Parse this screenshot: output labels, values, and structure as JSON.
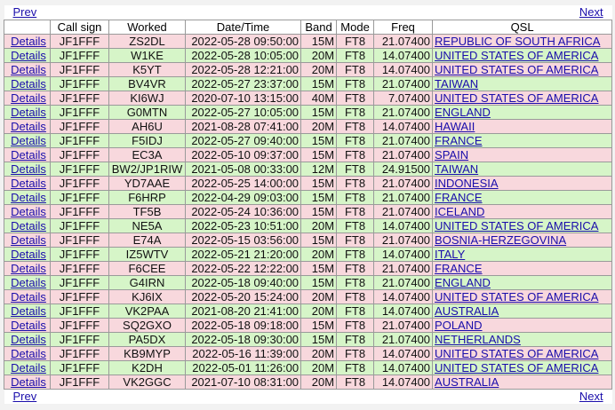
{
  "nav": {
    "prev": "Prev",
    "next": "Next"
  },
  "headers": [
    "",
    "Call sign",
    "Worked",
    "Date/Time",
    "Band",
    "Mode",
    "Freq",
    "QSL"
  ],
  "details_label": "Details",
  "rows": [
    {
      "call": "JF1FFF",
      "worked": "ZS2DL",
      "dt": "2022-05-28 09:50:00",
      "band": "15M",
      "mode": "FT8",
      "freq": "21.07400",
      "qsl": "REPUBLIC OF SOUTH AFRICA"
    },
    {
      "call": "JF1FFF",
      "worked": "W1KE",
      "dt": "2022-05-28 10:05:00",
      "band": "20M",
      "mode": "FT8",
      "freq": "14.07400",
      "qsl": "UNITED STATES OF AMERICA"
    },
    {
      "call": "JF1FFF",
      "worked": "K5YT",
      "dt": "2022-05-28 12:21:00",
      "band": "20M",
      "mode": "FT8",
      "freq": "14.07400",
      "qsl": "UNITED STATES OF AMERICA"
    },
    {
      "call": "JF1FFF",
      "worked": "BV4VR",
      "dt": "2022-05-27 23:37:00",
      "band": "15M",
      "mode": "FT8",
      "freq": "21.07400",
      "qsl": "TAIWAN"
    },
    {
      "call": "JF1FFF",
      "worked": "KI6WJ",
      "dt": "2020-07-10 13:15:00",
      "band": "40M",
      "mode": "FT8",
      "freq": "7.07400",
      "qsl": "UNITED STATES OF AMERICA"
    },
    {
      "call": "JF1FFF",
      "worked": "G0MTN",
      "dt": "2022-05-27 10:05:00",
      "band": "15M",
      "mode": "FT8",
      "freq": "21.07400",
      "qsl": "ENGLAND"
    },
    {
      "call": "JF1FFF",
      "worked": "AH6U",
      "dt": "2021-08-28 07:41:00",
      "band": "20M",
      "mode": "FT8",
      "freq": "14.07400",
      "qsl": "HAWAII"
    },
    {
      "call": "JF1FFF",
      "worked": "F5IDJ",
      "dt": "2022-05-27 09:40:00",
      "band": "15M",
      "mode": "FT8",
      "freq": "21.07400",
      "qsl": "FRANCE"
    },
    {
      "call": "JF1FFF",
      "worked": "EC3A",
      "dt": "2022-05-10 09:37:00",
      "band": "15M",
      "mode": "FT8",
      "freq": "21.07400",
      "qsl": "SPAIN"
    },
    {
      "call": "JF1FFF",
      "worked": "BW2/JP1RIW",
      "dt": "2021-05-08 00:33:00",
      "band": "12M",
      "mode": "FT8",
      "freq": "24.91500",
      "qsl": "TAIWAN"
    },
    {
      "call": "JF1FFF",
      "worked": "YD7AAE",
      "dt": "2022-05-25 14:00:00",
      "band": "15M",
      "mode": "FT8",
      "freq": "21.07400",
      "qsl": "INDONESIA"
    },
    {
      "call": "JF1FFF",
      "worked": "F6HRP",
      "dt": "2022-04-29 09:03:00",
      "band": "15M",
      "mode": "FT8",
      "freq": "21.07400",
      "qsl": "FRANCE"
    },
    {
      "call": "JF1FFF",
      "worked": "TF5B",
      "dt": "2022-05-24 10:36:00",
      "band": "15M",
      "mode": "FT8",
      "freq": "21.07400",
      "qsl": "ICELAND"
    },
    {
      "call": "JF1FFF",
      "worked": "NE5A",
      "dt": "2022-05-23 10:51:00",
      "band": "20M",
      "mode": "FT8",
      "freq": "14.07400",
      "qsl": "UNITED STATES OF AMERICA"
    },
    {
      "call": "JF1FFF",
      "worked": "E74A",
      "dt": "2022-05-15 03:56:00",
      "band": "15M",
      "mode": "FT8",
      "freq": "21.07400",
      "qsl": "BOSNIA-HERZEGOVINA"
    },
    {
      "call": "JF1FFF",
      "worked": "IZ5WTV",
      "dt": "2022-05-21 21:20:00",
      "band": "20M",
      "mode": "FT8",
      "freq": "14.07400",
      "qsl": "ITALY"
    },
    {
      "call": "JF1FFF",
      "worked": "F6CEE",
      "dt": "2022-05-22 12:22:00",
      "band": "15M",
      "mode": "FT8",
      "freq": "21.07400",
      "qsl": "FRANCE"
    },
    {
      "call": "JF1FFF",
      "worked": "G4IRN",
      "dt": "2022-05-18 09:40:00",
      "band": "15M",
      "mode": "FT8",
      "freq": "21.07400",
      "qsl": "ENGLAND"
    },
    {
      "call": "JF1FFF",
      "worked": "KJ6IX",
      "dt": "2022-05-20 15:24:00",
      "band": "20M",
      "mode": "FT8",
      "freq": "14.07400",
      "qsl": "UNITED STATES OF AMERICA"
    },
    {
      "call": "JF1FFF",
      "worked": "VK2PAA",
      "dt": "2021-08-20 21:41:00",
      "band": "20M",
      "mode": "FT8",
      "freq": "14.07400",
      "qsl": "AUSTRALIA"
    },
    {
      "call": "JF1FFF",
      "worked": "SQ2GXO",
      "dt": "2022-05-18 09:18:00",
      "band": "15M",
      "mode": "FT8",
      "freq": "21.07400",
      "qsl": "POLAND"
    },
    {
      "call": "JF1FFF",
      "worked": "PA5DX",
      "dt": "2022-05-18 09:30:00",
      "band": "15M",
      "mode": "FT8",
      "freq": "21.07400",
      "qsl": "NETHERLANDS"
    },
    {
      "call": "JF1FFF",
      "worked": "KB9MYP",
      "dt": "2022-05-16 11:39:00",
      "band": "20M",
      "mode": "FT8",
      "freq": "14.07400",
      "qsl": "UNITED STATES OF AMERICA"
    },
    {
      "call": "JF1FFF",
      "worked": "K2DH",
      "dt": "2022-05-01 11:26:00",
      "band": "20M",
      "mode": "FT8",
      "freq": "14.07400",
      "qsl": "UNITED STATES OF AMERICA"
    },
    {
      "call": "JF1FFF",
      "worked": "VK2GGC",
      "dt": "2021-07-10 08:31:00",
      "band": "20M",
      "mode": "FT8",
      "freq": "14.07400",
      "qsl": "AUSTRALIA"
    }
  ]
}
